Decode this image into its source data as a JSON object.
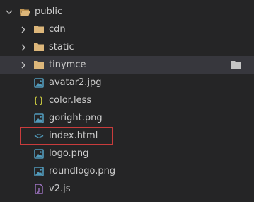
{
  "explorer": {
    "root": {
      "label": "public",
      "expanded": true,
      "icon": "folder-open-icon"
    },
    "items": [
      {
        "label": "cdn",
        "type": "folder",
        "icon": "folder-icon"
      },
      {
        "label": "static",
        "type": "folder",
        "icon": "folder-icon"
      },
      {
        "label": "tinymce",
        "type": "folder",
        "icon": "folder-icon",
        "hovered": true
      },
      {
        "label": "avatar2.jpg",
        "type": "image",
        "icon": "image-file-icon"
      },
      {
        "label": "color.less",
        "type": "less",
        "icon": "braces-file-icon"
      },
      {
        "label": "goright.png",
        "type": "image",
        "icon": "image-file-icon"
      },
      {
        "label": "index.html",
        "type": "html",
        "icon": "code-file-icon",
        "highlighted": true
      },
      {
        "label": "logo.png",
        "type": "image",
        "icon": "image-file-icon"
      },
      {
        "label": "roundlogo.png",
        "type": "image",
        "icon": "image-file-icon"
      },
      {
        "label": "v2.js",
        "type": "js",
        "icon": "js-file-icon"
      }
    ]
  },
  "colors": {
    "background": "#252526",
    "hover_row": "#37373d",
    "folder": "#dcb67a",
    "image_icon": "#519aba",
    "less_icon": "#cbcb41",
    "html_icon": "#519aba",
    "js_icon": "#a074c4",
    "highlight_border": "#c93c3c"
  }
}
